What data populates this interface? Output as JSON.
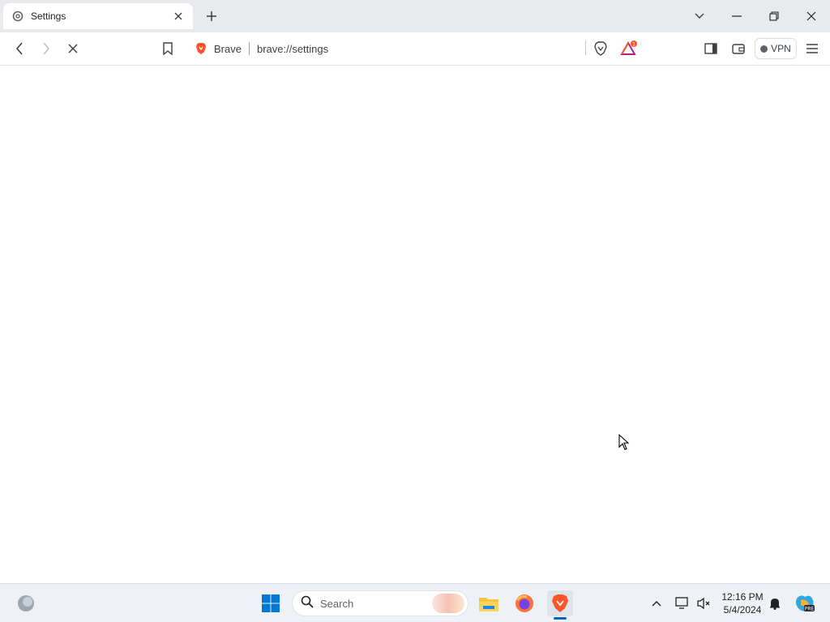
{
  "browser": {
    "tab": {
      "title": "Settings",
      "favicon": "settings-gear-icon"
    },
    "omnibox": {
      "site_name": "Brave",
      "url": "brave://settings"
    },
    "vpn_label": "VPN",
    "rewards_badge": "1"
  },
  "taskbar": {
    "search_label": "Search",
    "clock": {
      "time": "12:16 PM",
      "date": "5/4/2024"
    }
  },
  "colors": {
    "brave_orange": "#fb542b",
    "windows_blue": "#0078d4",
    "tabstrip_bg": "#e8eaed"
  }
}
